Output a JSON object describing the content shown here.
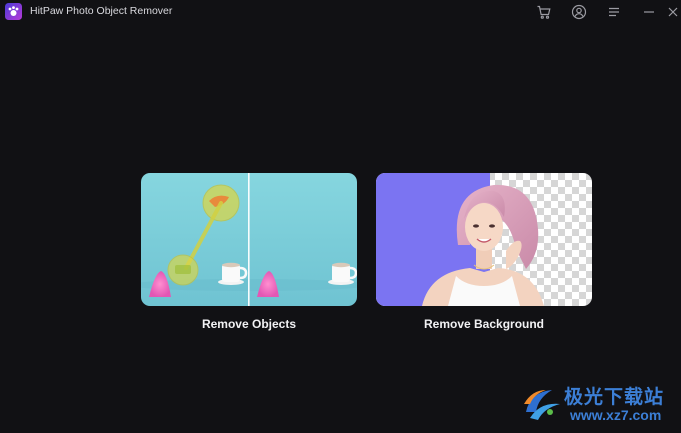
{
  "window": {
    "title": "HitPaw Photo Object Remover",
    "logo_icon": "hitpaw-logo-icon",
    "buttons": [
      {
        "name": "cart-icon"
      },
      {
        "name": "account-icon"
      },
      {
        "name": "menu-icon"
      },
      {
        "name": "minimize-icon"
      },
      {
        "name": "close-icon"
      }
    ]
  },
  "features": [
    {
      "label": "Remove Objects"
    },
    {
      "label": "Remove Background"
    }
  ],
  "watermark": {
    "text": "极光下载站",
    "url": "www.xz7.com"
  },
  "colors": {
    "background": "#111114",
    "card_objects_bg": "#7fcfda",
    "card_background_bg": "#7b74f2",
    "watermark": "#3c7fd6"
  }
}
